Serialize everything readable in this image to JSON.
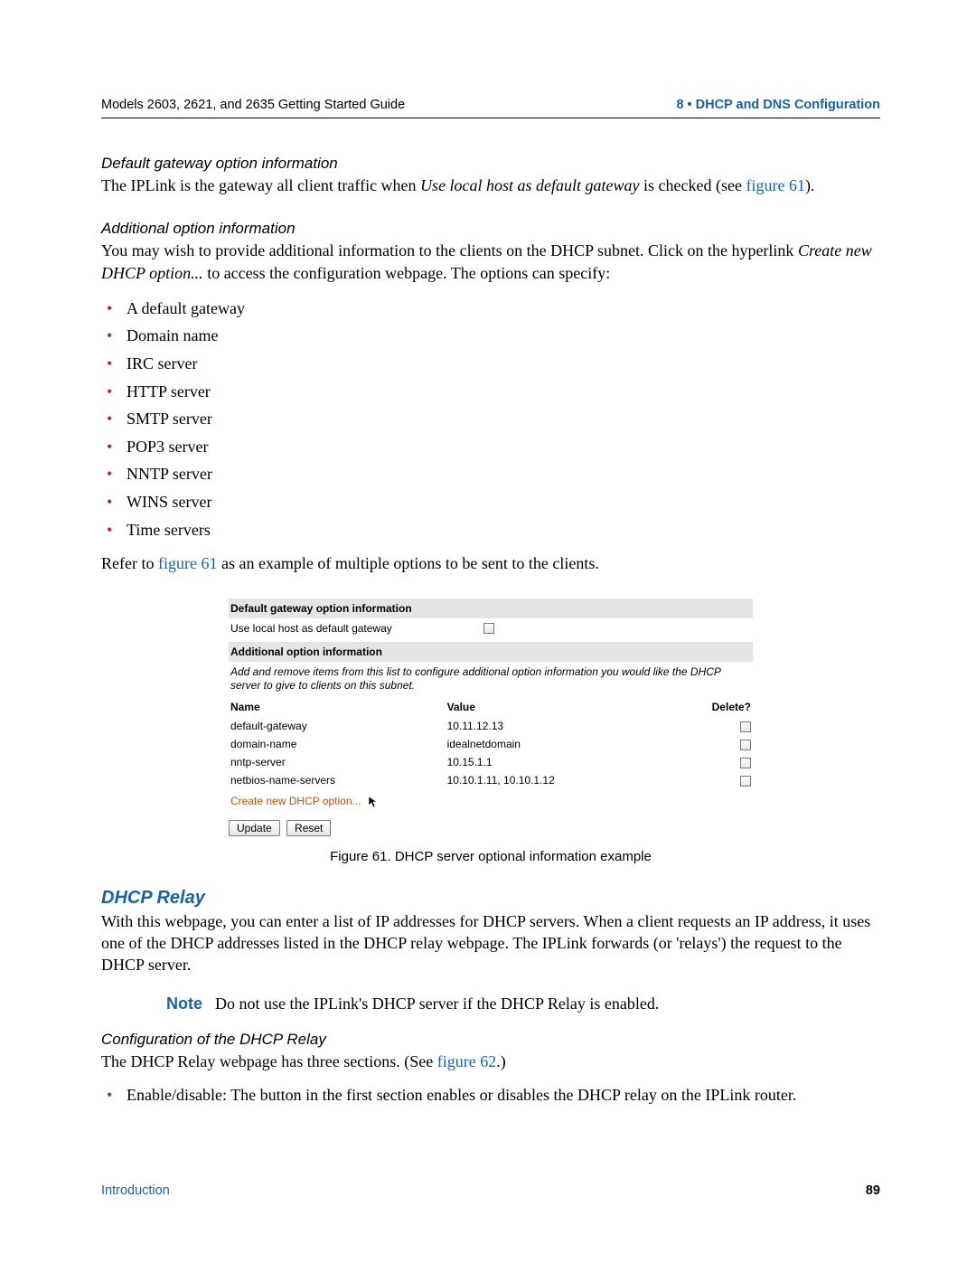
{
  "header": {
    "left": "Models 2603, 2621, and 2635 Getting Started Guide",
    "right": "8 • DHCP and DNS Configuration"
  },
  "sec1": {
    "heading": "Default gateway option information",
    "p1_a": "The IPLink is the gateway all client traffic when ",
    "p1_ital": "Use local host as default gateway",
    "p1_b": " is checked (see ",
    "p1_link": "figure 61",
    "p1_c": ")."
  },
  "sec2": {
    "heading": "Additional option information",
    "p1_a": "You may wish to provide additional information to the clients on the DHCP subnet. Click on the hyperlink ",
    "p1_ital": "Create new DHCP option...",
    "p1_b": " to access the configuration webpage. The options can specify:",
    "bullets": [
      "A default gateway",
      "Domain name",
      "IRC server",
      "HTTP server",
      "SMTP server",
      "POP3 server",
      "NNTP server",
      "WINS server",
      "Time servers"
    ],
    "refer_a": "Refer to ",
    "refer_link": "figure 61",
    "refer_b": " as an example of multiple options to be sent to the clients."
  },
  "figure": {
    "head1": "Default gateway option information",
    "row1_label": "Use local host as default gateway",
    "head2": "Additional option information",
    "desc": "Add and remove items from this list to configure additional option information you would like the DHCP server to give to clients on this subnet.",
    "th_name": "Name",
    "th_value": "Value",
    "th_delete": "Delete?",
    "rows": [
      {
        "name": "default-gateway",
        "value": "10.11.12.13"
      },
      {
        "name": "domain-name",
        "value": "idealnetdomain"
      },
      {
        "name": "nntp-server",
        "value": "10.15.1.1"
      },
      {
        "name": "netbios-name-servers",
        "value": "10.10.1.11, 10.10.1.12"
      }
    ],
    "create_link": "Create new DHCP option...",
    "btn_update": "Update",
    "btn_reset": "Reset",
    "caption": "Figure 61. DHCP server optional information example"
  },
  "relay": {
    "heading": "DHCP Relay",
    "p1": "With this webpage, you can enter a list of IP addresses for DHCP servers. When a client requests an IP address, it uses one of the DHCP addresses listed in the DHCP relay webpage. The IPLink forwards (or 'relays') the request to the DHCP server.",
    "note_label": "Note",
    "note_text": "Do not use the IPLink's DHCP server if the DHCP Relay is enabled.",
    "sub_heading": "Configuration of the DHCP Relay",
    "p2_a": "The DHCP Relay webpage has three sections. (See ",
    "p2_link": "figure 62",
    "p2_b": ".)",
    "bullet1": "Enable/disable: The button in the first section enables or disables the DHCP relay on the IPLink router."
  },
  "footer": {
    "left": "Introduction",
    "right": "89"
  }
}
